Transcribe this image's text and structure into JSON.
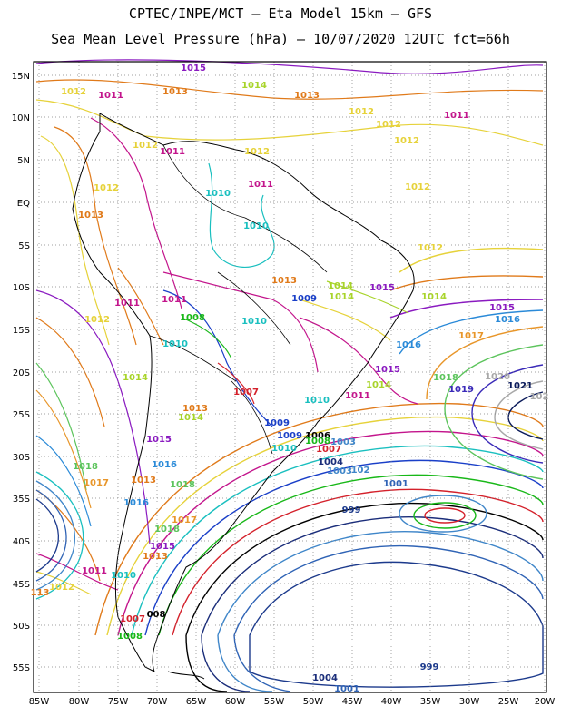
{
  "header": {
    "line1": "CPTEC/INPE/MCT –  Eta Model 15km – GFS",
    "line2": "Sea Mean Level Pressure (hPa) – 10/07/2020 12UTC fct=66h"
  },
  "axes": {
    "lat_labels": [
      "15N",
      "10N",
      "5N",
      "EQ",
      "5S",
      "10S",
      "15S",
      "20S",
      "25S",
      "30S",
      "35S",
      "40S",
      "45S",
      "50S",
      "55S"
    ],
    "lon_labels": [
      "85W",
      "80W",
      "75W",
      "70W",
      "65W",
      "60W",
      "55W",
      "50W",
      "45W",
      "40W",
      "35W",
      "30W",
      "25W",
      "20W"
    ]
  },
  "colors": {
    "999": "#1c3a8c",
    "1001": "#2f63b5",
    "1003": "#3f86c9",
    "1004": "#1a2d7a",
    "1006": "#000000",
    "1007": "#d4212b",
    "1008": "#18b818",
    "1009": "#1a3fc8",
    "1010": "#19bfbf",
    "1011": "#c3158c",
    "1012": "#e6d23a",
    "1013": "#e07a1a",
    "1014": "#a8d42a",
    "1015": "#8a1ac0",
    "1016": "#2a8ad8",
    "1017": "#e8962a",
    "1018": "#5cc45c",
    "1019": "#3a2ab8",
    "1020": "#a8a8a8",
    "1021": "#0a1a5a",
    "coast": "#000000",
    "grid": "#808080"
  },
  "contour_labels": [
    {
      "text": "1015",
      "k": "1015"
    },
    {
      "text": "1012",
      "k": "1012"
    },
    {
      "text": "1011",
      "k": "1011"
    },
    {
      "text": "1013",
      "k": "1013"
    },
    {
      "text": "1014",
      "k": "1014"
    },
    {
      "text": "1013",
      "k": "1013"
    },
    {
      "text": "1012",
      "k": "1012"
    },
    {
      "text": "1012",
      "k": "1012"
    },
    {
      "text": "1011",
      "k": "1011"
    },
    {
      "text": "1012",
      "k": "1012"
    },
    {
      "text": "1011",
      "k": "1011"
    },
    {
      "text": "1012",
      "k": "1012"
    },
    {
      "text": "1012",
      "k": "1012"
    },
    {
      "text": "1012",
      "k": "1012"
    },
    {
      "text": "1011",
      "k": "1011"
    },
    {
      "text": "1010",
      "k": "1010"
    },
    {
      "text": "1013",
      "k": "1013"
    },
    {
      "text": "1010",
      "k": "1010"
    },
    {
      "text": "1012",
      "k": "1012"
    },
    {
      "text": "1011",
      "k": "1011"
    },
    {
      "text": "1013",
      "k": "1013"
    },
    {
      "text": "1011",
      "k": "1011"
    },
    {
      "text": "1009",
      "k": "1009"
    },
    {
      "text": "1012",
      "k": "1012"
    },
    {
      "text": "1014",
      "k": "1014"
    },
    {
      "text": "1015",
      "k": "1015"
    },
    {
      "text": "1014",
      "k": "1014"
    },
    {
      "text": "1015",
      "k": "1015"
    },
    {
      "text": "1016",
      "k": "1016"
    },
    {
      "text": "1008",
      "k": "1008"
    },
    {
      "text": "1010",
      "k": "1010"
    },
    {
      "text": "1014",
      "k": "1014"
    },
    {
      "text": "1012",
      "k": "1012"
    },
    {
      "text": "1010",
      "k": "1010"
    },
    {
      "text": "1017",
      "k": "1017"
    },
    {
      "text": "1016",
      "k": "1016"
    },
    {
      "text": "1014",
      "k": "1014"
    },
    {
      "text": "1015",
      "k": "1015"
    },
    {
      "text": "1018",
      "k": "1018"
    },
    {
      "text": "1020",
      "k": "1020"
    },
    {
      "text": "1007",
      "k": "1007"
    },
    {
      "text": "1010",
      "k": "1010"
    },
    {
      "text": "1011",
      "k": "1011"
    },
    {
      "text": "1014",
      "k": "1014"
    },
    {
      "text": "1019",
      "k": "1019"
    },
    {
      "text": "1021",
      "k": "1021"
    },
    {
      "text": "102",
      "k": "1020"
    },
    {
      "text": "1013",
      "k": "1013"
    },
    {
      "text": "1014",
      "k": "1014"
    },
    {
      "text": "1009",
      "k": "1009"
    },
    {
      "text": "1009",
      "k": "1009"
    },
    {
      "text": "1006",
      "k": "1006"
    },
    {
      "text": "1008",
      "k": "1008"
    },
    {
      "text": "1007",
      "k": "1007"
    },
    {
      "text": "1003",
      "k": "1003"
    },
    {
      "text": "1015",
      "k": "1015"
    },
    {
      "text": "1010",
      "k": "1010"
    },
    {
      "text": "1004",
      "k": "1004"
    },
    {
      "text": "1003",
      "k": "1003"
    },
    {
      "text": "102",
      "k": "1003"
    },
    {
      "text": "1018",
      "k": "1018"
    },
    {
      "text": "1017",
      "k": "1017"
    },
    {
      "text": "1013",
      "k": "1013"
    },
    {
      "text": "1016",
      "k": "1016"
    },
    {
      "text": "1018",
      "k": "1018"
    },
    {
      "text": "1001",
      "k": "1001"
    },
    {
      "text": "1016",
      "k": "1016"
    },
    {
      "text": "1017",
      "k": "1017"
    },
    {
      "text": "999",
      "k": "999"
    },
    {
      "text": "1018",
      "k": "1018"
    },
    {
      "text": "1015",
      "k": "1015"
    },
    {
      "text": "1013",
      "k": "1013"
    },
    {
      "text": "1011",
      "k": "1011"
    },
    {
      "text": "1010",
      "k": "1010"
    },
    {
      "text": "1012",
      "k": "1012"
    },
    {
      "text": "113",
      "k": "1013"
    },
    {
      "text": "1007",
      "k": "1007"
    },
    {
      "text": "008",
      "k": "1006"
    },
    {
      "text": "1008",
      "k": "1008"
    },
    {
      "text": "999",
      "k": "999"
    },
    {
      "text": "1004",
      "k": "1004"
    },
    {
      "text": "1001",
      "k": "1001"
    }
  ]
}
